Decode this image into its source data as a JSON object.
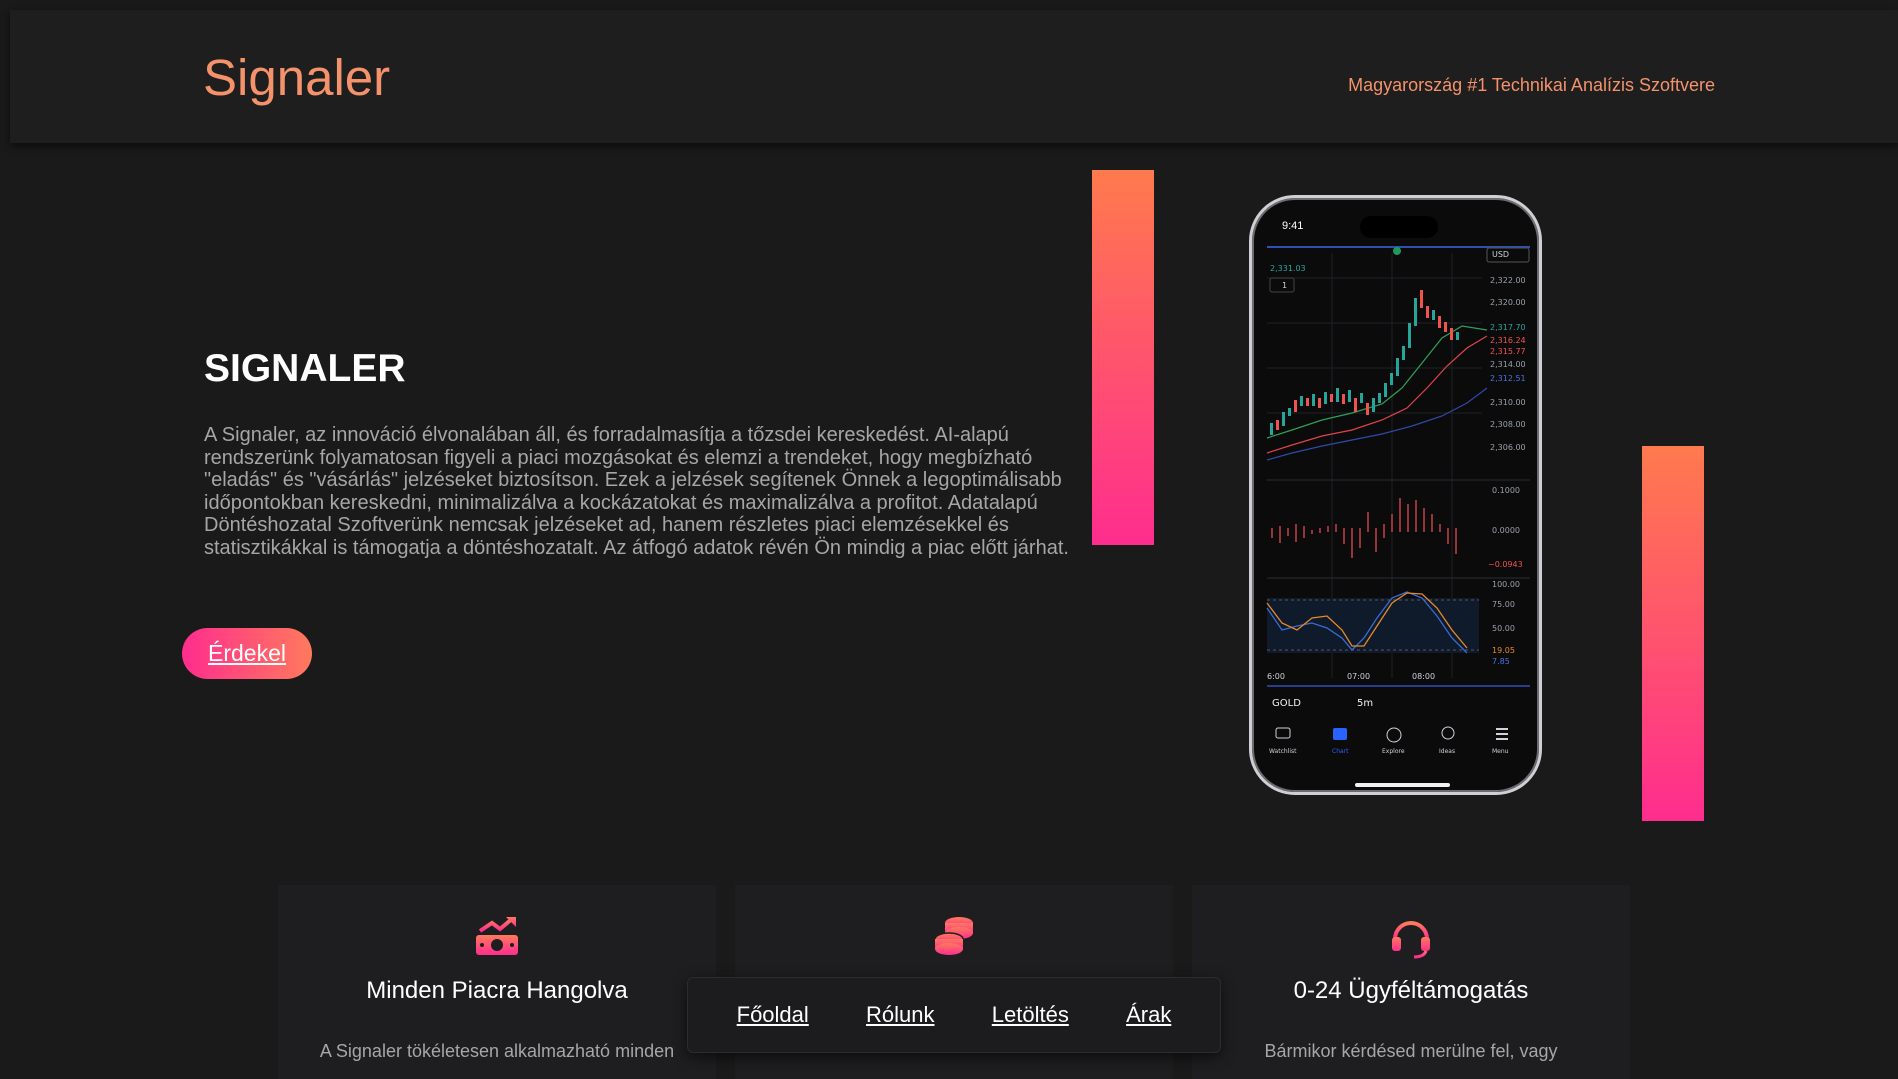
{
  "header": {
    "logo": "Signaler",
    "tagline": "Magyarország #1 Technikai Analízis Szoftvere"
  },
  "hero": {
    "title": "SIGNALER",
    "text": "A Signaler, az innováció élvonalában áll, és forradalmasítja a tőzsdei kereskedést. AI-alapú rendszerünk folyamatosan figyeli a piaci mozgásokat és elemzi a trendeket, hogy megbízható \"eladás\" és \"vásárlás\" jelzéseket biztosítson. Ezek a jelzések segítenek Önnek a legoptimálisabb időpontokban kereskedni, minimalizálva a kockázatokat és maximalizálva a profitot. Adatalapú Döntéshozatal Szoftverünk nemcsak jelzéseket ad, hanem részletes piaci elemzésekkel és statisztikákkal is támogatja a döntéshozatalt. Az átfogó adatok révén Ön mindig a piac előtt járhat.",
    "cta_label": "Érdekel"
  },
  "phone": {
    "time": "9:41",
    "currency": "USD",
    "price_top": "2,331.03",
    "interval_badge": "1",
    "price_ticks": [
      "2,322.00",
      "2,320.00",
      "2,317.70",
      "2,316.24",
      "2,315.77",
      "2,314.00",
      "2,312.51",
      "2,310.00",
      "2,308.00",
      "2,306.00"
    ],
    "macd_ticks": [
      "0.1000",
      "0.0000",
      "−0.0943"
    ],
    "stoch_ticks": [
      "100.00",
      "75.00",
      "50.00",
      "19.05",
      "7.85"
    ],
    "time_ticks": [
      "6:00",
      "07:00",
      "08:00"
    ],
    "symbol": "GOLD",
    "timeframe": "5m",
    "tabs": [
      "Watchlist",
      "Chart",
      "Explore",
      "Ideas",
      "Menu"
    ]
  },
  "features": [
    {
      "icon": "money-growth-icon",
      "title": "Minden Piacra Hangolva",
      "text": "A Signaler tökéletesen alkalmazható minden"
    },
    {
      "icon": "coins-stack-icon",
      "title": "",
      "text": ""
    },
    {
      "icon": "headset-icon",
      "title": "0-24 Ügyféltámogatás",
      "text": "Bármikor kérdésed merülne fel, vagy"
    }
  ],
  "nav": {
    "items": [
      "Főoldal",
      "Rólunk",
      "Letöltés",
      "Árak"
    ]
  },
  "colors": {
    "accent": "#f3926b",
    "gradient_start": "#ff2d8e",
    "gradient_end": "#ff7a5c",
    "background": "#1a1a1b"
  }
}
